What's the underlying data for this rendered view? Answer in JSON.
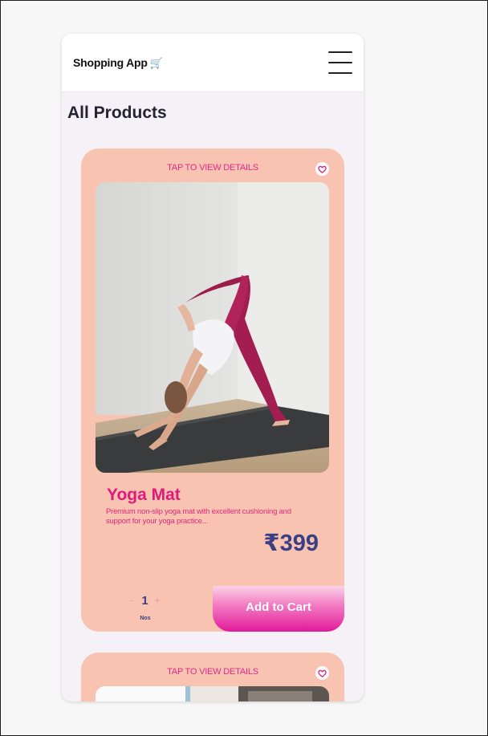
{
  "header": {
    "title": "Shopping App",
    "cart_icon": "🛒"
  },
  "page": {
    "title": "All Products"
  },
  "products": [
    {
      "tap_label": "TAP TO VIEW DETAILS",
      "name": "Yoga Mat",
      "description": "Premium non-slip yoga mat with excellent cushioning and support for your yoga practice...",
      "price": "₹399",
      "quantity": {
        "minus": "-",
        "value": "1",
        "plus": "+",
        "unit": "Nos"
      },
      "add_to_cart_label": "Add to Cart"
    },
    {
      "tap_label": "TAP TO VIEW DETAILS"
    }
  ],
  "colors": {
    "card_bg": "#f8c3b1",
    "accent_pink": "#e0197d",
    "price_navy": "#3a3f86",
    "button_gradient_end": "#e21a9b"
  },
  "icons": {
    "menu": "hamburger-menu-icon",
    "favorite": "heart-icon",
    "cart": "cart-icon"
  }
}
